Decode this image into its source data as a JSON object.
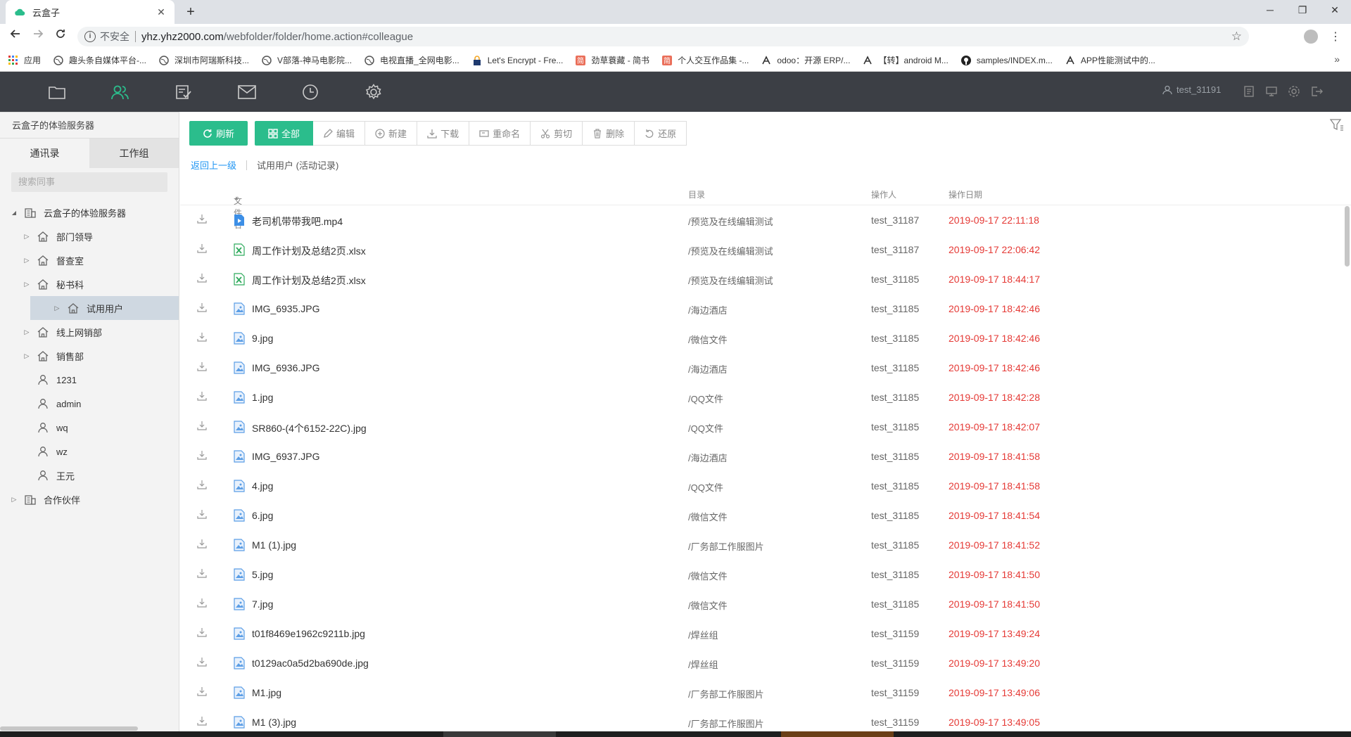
{
  "browser": {
    "tab_title": "云盒子",
    "insecure_label": "不安全",
    "url_host": "yhz.yhz2000.com",
    "url_path": "/webfolder/folder/home.action#colleague",
    "bookmarks": [
      "应用",
      "趣头条自媒体平台-...",
      "深圳市阿瑞斯科技...",
      "V部落-神马电影院...",
      "电视直播_全网电影...",
      "Let's Encrypt - Fre...",
      "劲草蓑藏 - 简书",
      "个人交互作品集 -...",
      "odoo：开源 ERP/...",
      "【转】android M...",
      "samples/INDEX.m...",
      "APP性能测试中的..."
    ]
  },
  "header": {
    "user": "test_31191"
  },
  "sidebar": {
    "server_title": "云盒子的体验服务器",
    "tabs": [
      "通讯录",
      "工作组"
    ],
    "search_placeholder": "搜索同事",
    "tree": [
      {
        "label": "云盒子的体验服务器",
        "type": "org",
        "level": 0,
        "arrow": "down"
      },
      {
        "label": "部门领导",
        "type": "dept",
        "level": 1,
        "arrow": "right"
      },
      {
        "label": "督查室",
        "type": "dept",
        "level": 1,
        "arrow": "right"
      },
      {
        "label": "秘书科",
        "type": "dept",
        "level": 1,
        "arrow": "right"
      },
      {
        "label": "试用用户",
        "type": "dept",
        "level": 1,
        "arrow": "right",
        "selected": true
      },
      {
        "label": "线上网销部",
        "type": "dept",
        "level": 1,
        "arrow": "right"
      },
      {
        "label": "销售部",
        "type": "dept",
        "level": 1,
        "arrow": "right"
      },
      {
        "label": "1231",
        "type": "user",
        "level": 1,
        "arrow": ""
      },
      {
        "label": "admin",
        "type": "user",
        "level": 1,
        "arrow": ""
      },
      {
        "label": "wq",
        "type": "user",
        "level": 1,
        "arrow": ""
      },
      {
        "label": "wz",
        "type": "user",
        "level": 1,
        "arrow": ""
      },
      {
        "label": "王元",
        "type": "user",
        "level": 1,
        "arrow": ""
      },
      {
        "label": "合作伙伴",
        "type": "org",
        "level": 0,
        "arrow": "right"
      }
    ]
  },
  "actions": {
    "refresh": "刷新",
    "all": "全部",
    "edit": "编辑",
    "new": "新建",
    "download": "下载",
    "rename": "重命名",
    "cut": "剪切",
    "delete": "删除",
    "restore": "还原"
  },
  "breadcrumb": {
    "back": "返回上一级",
    "current": "试用用户 (活动记录)"
  },
  "table": {
    "columns": {
      "name": "文件名",
      "dir": "目录",
      "operator": "操作人",
      "date": "操作日期"
    },
    "rows": [
      {
        "name": "老司机带带我吧.mp4",
        "type": "video",
        "dir": "/预览及在线编辑测试",
        "operator": "test_31187",
        "date": "2019-09-17 22:11:18"
      },
      {
        "name": "周工作计划及总结2页.xlsx",
        "type": "excel",
        "dir": "/预览及在线编辑测试",
        "operator": "test_31187",
        "date": "2019-09-17 22:06:42"
      },
      {
        "name": "周工作计划及总结2页.xlsx",
        "type": "excel",
        "dir": "/预览及在线编辑测试",
        "operator": "test_31185",
        "date": "2019-09-17 18:44:17"
      },
      {
        "name": "IMG_6935.JPG",
        "type": "image",
        "dir": "/海边酒店",
        "operator": "test_31185",
        "date": "2019-09-17 18:42:46"
      },
      {
        "name": "9.jpg",
        "type": "image",
        "dir": "/微信文件",
        "operator": "test_31185",
        "date": "2019-09-17 18:42:46"
      },
      {
        "name": "IMG_6936.JPG",
        "type": "image",
        "dir": "/海边酒店",
        "operator": "test_31185",
        "date": "2019-09-17 18:42:46"
      },
      {
        "name": "1.jpg",
        "type": "image",
        "dir": "/QQ文件",
        "operator": "test_31185",
        "date": "2019-09-17 18:42:28"
      },
      {
        "name": "SR860-(4个6152-22C).jpg",
        "type": "image",
        "dir": "/QQ文件",
        "operator": "test_31185",
        "date": "2019-09-17 18:42:07"
      },
      {
        "name": "IMG_6937.JPG",
        "type": "image",
        "dir": "/海边酒店",
        "operator": "test_31185",
        "date": "2019-09-17 18:41:58"
      },
      {
        "name": "4.jpg",
        "type": "image",
        "dir": "/QQ文件",
        "operator": "test_31185",
        "date": "2019-09-17 18:41:58"
      },
      {
        "name": "6.jpg",
        "type": "image",
        "dir": "/微信文件",
        "operator": "test_31185",
        "date": "2019-09-17 18:41:54"
      },
      {
        "name": "M1 (1).jpg",
        "type": "image",
        "dir": "/厂务部工作服图片",
        "operator": "test_31185",
        "date": "2019-09-17 18:41:52"
      },
      {
        "name": "5.jpg",
        "type": "image",
        "dir": "/微信文件",
        "operator": "test_31185",
        "date": "2019-09-17 18:41:50"
      },
      {
        "name": "7.jpg",
        "type": "image",
        "dir": "/微信文件",
        "operator": "test_31185",
        "date": "2019-09-17 18:41:50"
      },
      {
        "name": "t01f8469e1962c9211b.jpg",
        "type": "image",
        "dir": "/焊丝组",
        "operator": "test_31159",
        "date": "2019-09-17 13:49:24"
      },
      {
        "name": "t0129ac0a5d2ba690de.jpg",
        "type": "image",
        "dir": "/焊丝组",
        "operator": "test_31159",
        "date": "2019-09-17 13:49:20"
      },
      {
        "name": "M1.jpg",
        "type": "image",
        "dir": "/厂务部工作服图片",
        "operator": "test_31159",
        "date": "2019-09-17 13:49:06"
      },
      {
        "name": "M1 (3).jpg",
        "type": "image",
        "dir": "/厂务部工作服图片",
        "operator": "test_31159",
        "date": "2019-09-17 13:49:05"
      }
    ]
  },
  "colors": {
    "accent": "#2bbd8c",
    "header_bg": "#3c3f45",
    "date_red": "#e53935",
    "link_blue": "#2196f3"
  }
}
